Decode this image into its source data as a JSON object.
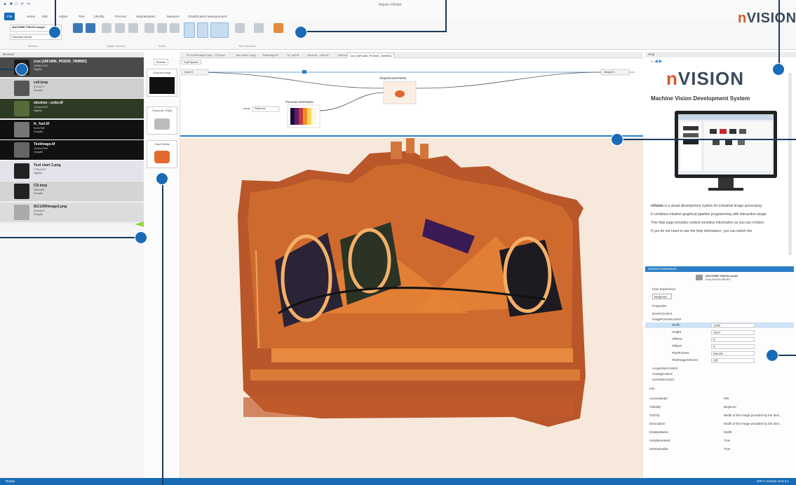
{
  "window": {
    "title": "Impuls nVision"
  },
  "menu": [
    {
      "label": "File",
      "active": true
    },
    {
      "label": "Home"
    },
    {
      "label": "Edit"
    },
    {
      "label": "Adjust"
    },
    {
      "label": "Tool"
    },
    {
      "label": "Identify"
    },
    {
      "label": "Process"
    },
    {
      "label": "Segmentation"
    },
    {
      "label": "Measure"
    },
    {
      "label": "Classification Measurement"
    }
  ],
  "ribbon": {
    "device_name": "MACHINE VISION Imager",
    "device_sub": "EVALUATION Series",
    "device_field": "Standard device",
    "groups": [
      "Devices",
      "Adjust Camera",
      "Zoom",
      "Tool Windows"
    ]
  },
  "logo": {
    "prefix": "n",
    "text": "VISION"
  },
  "browser": {
    "title": "Browser",
    "items": [
      {
        "name": "Live [18F1806_P03535_789B9D]",
        "meta1": "1936x1216",
        "meta2": "Rgb8u"
      },
      {
        "name": "cell.bmp",
        "meta1": "472x477",
        "meta2": "Gray8u"
      },
      {
        "name": "electron - color.tif",
        "meta1": "1216x1020",
        "meta2": "Rgb8u"
      },
      {
        "name": "fc_fuel.tif",
        "meta1": "512x768",
        "meta2": "Gray8u"
      },
      {
        "name": "Testimage.tif",
        "meta1": "1440x1296",
        "meta2": "Gray8u"
      },
      {
        "name": "Tool chart 2.png",
        "meta1": "776x1437",
        "meta2": "Rgb8u"
      },
      {
        "name": "CD.bmp",
        "meta1": "480x480",
        "meta2": "Gray8u"
      },
      {
        "name": "IEC1000image2.png",
        "meta1": "512x512",
        "meta2": "Gray8u"
      }
    ]
  },
  "toolbox": {
    "tab": "Browse",
    "cards": [
      "Original image",
      "Grayscale (Rgb)",
      "FalsePalette"
    ]
  },
  "doc_tabs": [
    "IEC1000image2.png",
    "CD.bmp",
    "Tool chart 2.png",
    "Testimage.tif",
    "fc_fuel.tif",
    "electron - color.tif",
    "cell.bmp",
    "Live [18F1806_P03535_789B9D]"
  ],
  "pipeline": {
    "subtab": "SubPipeline",
    "start_label": "Input 0",
    "end_label": "Output 0",
    "node_top": "ShapeDownPalette",
    "node_bottom": "PseudoColorPalette",
    "param_label": "name",
    "param_value": "Rainbow"
  },
  "help": {
    "title": "Help",
    "logo_prefix": "n",
    "logo": "VISION",
    "subtitle": "Machine Vision Development System",
    "p1_bold": "nVision",
    "p1": " is a visual development system for industrial image processing.",
    "p2": "It combines intuitive graphical pipeline programming with interactive usage.",
    "p3": "This help page provides context sensitive information as you use nVision.",
    "p4": "If you do not need to see the help information, you can switch the"
  },
  "camera": {
    "title": "Camera Parameters",
    "device": "MACHINE VISION model",
    "device_sub": "EVALUATION SERIES",
    "user_exp_label": "User Experience",
    "user_exp_value": "Beginner",
    "properties_label": "Properties",
    "tree": [
      "DeviceControl",
      "ImageFormatControl",
      "AcquisitionControl",
      "AnalogControl",
      "UserSetControl"
    ],
    "props": [
      {
        "k": "Width",
        "v": "1280",
        "selected": true
      },
      {
        "k": "Height",
        "v": "1024"
      },
      {
        "k": "OffsetX",
        "v": "0"
      },
      {
        "k": "OffsetY",
        "v": "0"
      },
      {
        "k": "PixelFormat",
        "v": "Mono8"
      },
      {
        "k": "TestImageSelector",
        "v": "Off"
      }
    ],
    "info_label": "Info",
    "info": [
      {
        "k": "AccessMode",
        "v": "RW"
      },
      {
        "k": "Visibility",
        "v": "Beginner"
      },
      {
        "k": "ToolTip",
        "v": "Width of the image provided by the devi..."
      },
      {
        "k": "Description",
        "v": "Width of the image provided by the devi..."
      },
      {
        "k": "DisplayName",
        "v": "Width"
      },
      {
        "k": "IsImplemented",
        "v": "True"
      },
      {
        "k": "IsStreamable",
        "v": "True"
      }
    ]
  },
  "status": {
    "left": "Ready",
    "right": "100 %   nVision 10.6.3.1"
  },
  "colors": {
    "accent": "#1a6bb5",
    "arrow": "#8fd43b",
    "logo_accent": "#d9582c"
  }
}
